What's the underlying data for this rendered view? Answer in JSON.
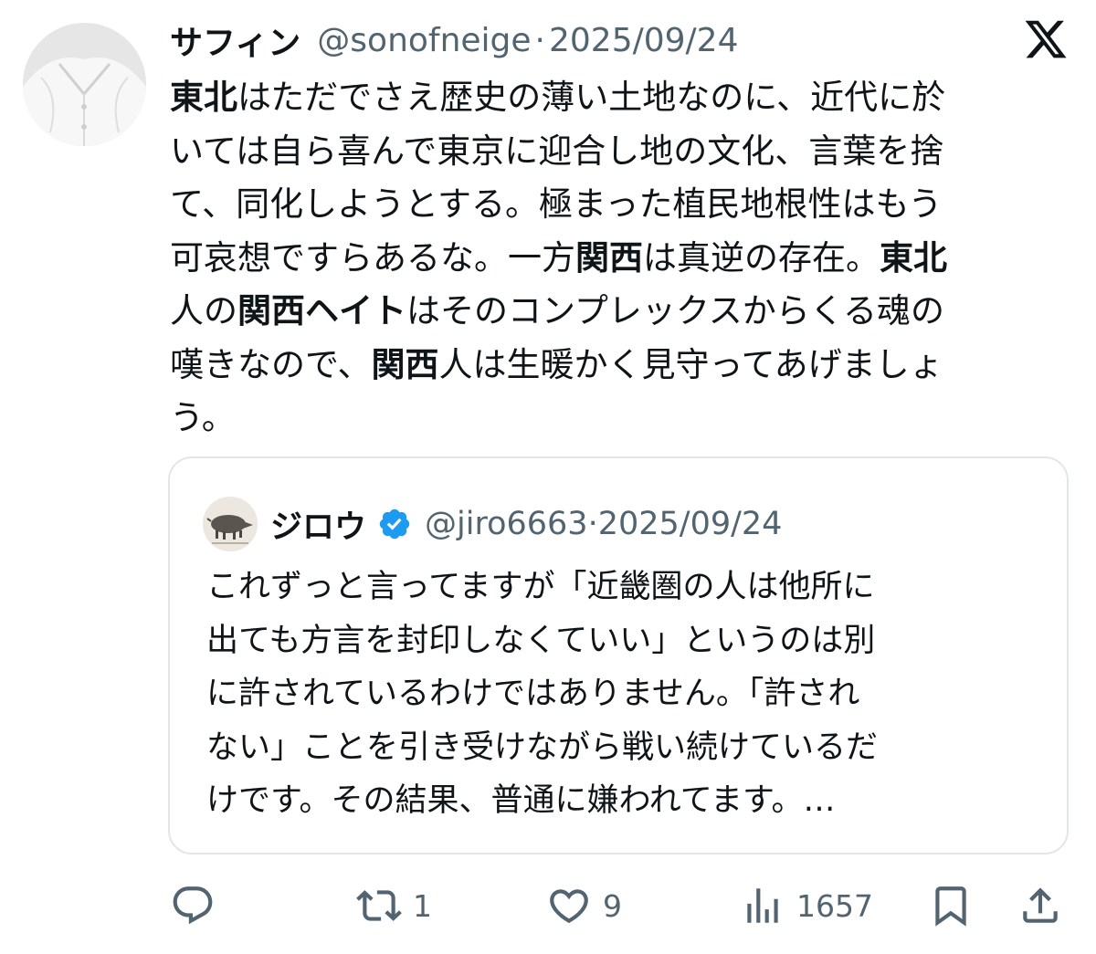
{
  "tweet": {
    "author": {
      "name": "サフィン",
      "handle": "@sonofneige",
      "date": "2025/09/24"
    },
    "separator": "·",
    "lines": [
      [
        {
          "t": "東北",
          "b": true
        },
        {
          "t": "はただでさえ歴史の薄い土地なのに、近代に於"
        }
      ],
      [
        {
          "t": "いては自ら喜んで東京に迎合し地の文化、言葉を捨"
        }
      ],
      [
        {
          "t": "て、同化しようとする。極まった植民地根性はもう"
        }
      ],
      [
        {
          "t": "可哀想ですらあるな。一方"
        },
        {
          "t": "関西",
          "b": true
        },
        {
          "t": "は真逆の存在。"
        },
        {
          "t": "東北",
          "b": true
        }
      ],
      [
        {
          "t": "人の"
        },
        {
          "t": "関西ヘイト",
          "b": true
        },
        {
          "t": "はそのコンプレックスからくる魂の"
        }
      ],
      [
        {
          "t": "嘆きなので、"
        },
        {
          "t": "関西",
          "b": true
        },
        {
          "t": "人は生暖かく見守ってあげましょ"
        }
      ],
      [
        {
          "t": "う。"
        }
      ]
    ]
  },
  "quote": {
    "author": {
      "name": "ジロウ",
      "handle": "@jiro6663",
      "date": "2025/09/24",
      "verified": true
    },
    "lines": [
      "これずっと言ってますが「近畿圏の人は他所に",
      "出ても方言を封印しなくていい」というのは別",
      "に許されているわけではありません。「許され",
      "ない」ことを引き受けながら戦い続けているだ",
      "けです。その結果、普通に嫌われてます。…"
    ]
  },
  "actions": {
    "reply": {
      "icon": "reply-icon"
    },
    "retweet": {
      "icon": "retweet-icon",
      "count": "1"
    },
    "like": {
      "icon": "heart-icon",
      "count": "9"
    },
    "views": {
      "icon": "views-icon",
      "count": "1657"
    },
    "bookmark": {
      "icon": "bookmark-icon"
    },
    "share": {
      "icon": "share-icon"
    }
  },
  "colors": {
    "text": "#0f1419",
    "secondary": "#536471",
    "border": "#e1e6ea",
    "verified": "#1d9bf0"
  }
}
